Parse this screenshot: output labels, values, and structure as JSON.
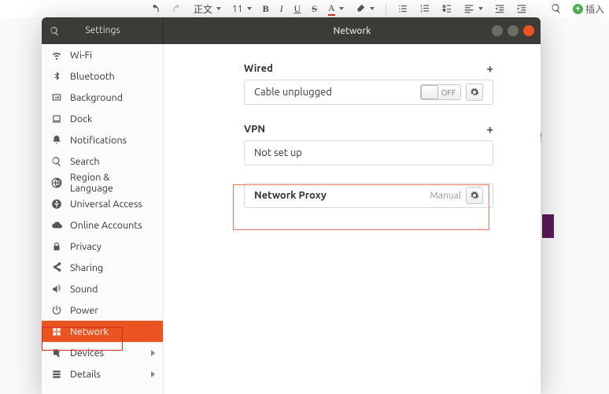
{
  "doc_toolbar": {
    "style_label": "正文",
    "font_size": "11",
    "insert_label": "插入"
  },
  "doc_spot_text": "理",
  "settings": {
    "app_title": "Settings",
    "page_title": "Network",
    "sidebar": [
      {
        "icon": "wifi",
        "label": "Wi-Fi"
      },
      {
        "icon": "bluetooth",
        "label": "Bluetooth"
      },
      {
        "icon": "background",
        "label": "Background"
      },
      {
        "icon": "dock",
        "label": "Dock"
      },
      {
        "icon": "bell",
        "label": "Notifications"
      },
      {
        "icon": "search",
        "label": "Search"
      },
      {
        "icon": "globe",
        "label": "Region & Language"
      },
      {
        "icon": "universal",
        "label": "Universal Access"
      },
      {
        "icon": "cloud",
        "label": "Online Accounts"
      },
      {
        "icon": "lock",
        "label": "Privacy"
      },
      {
        "icon": "share",
        "label": "Sharing"
      },
      {
        "icon": "sound",
        "label": "Sound"
      },
      {
        "icon": "power",
        "label": "Power"
      },
      {
        "icon": "network",
        "label": "Network",
        "active": true
      },
      {
        "icon": "devices",
        "label": "Devices",
        "chevron": true
      },
      {
        "icon": "details",
        "label": "Details",
        "chevron": true
      }
    ],
    "sections": {
      "wired": {
        "title": "Wired",
        "status": "Cable unplugged",
        "switch": "OFF"
      },
      "vpn": {
        "title": "VPN",
        "status": "Not set up"
      },
      "proxy": {
        "title": "Network Proxy",
        "mode": "Manual"
      }
    }
  }
}
